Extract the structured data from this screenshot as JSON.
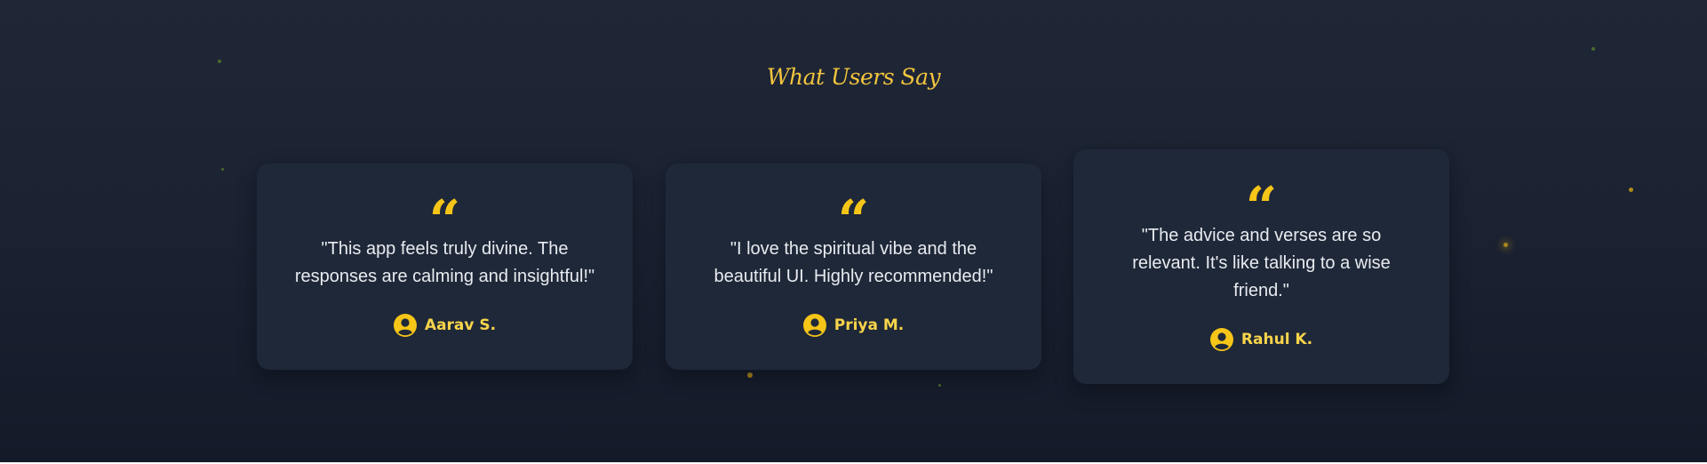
{
  "section": {
    "title": "What Users Say"
  },
  "testimonials": [
    {
      "quote_icon": "quote-left-icon",
      "text": "\"This app feels truly divine. The responses are calming and insightful!\"",
      "author": "Aarav S.",
      "avatar_icon": "user-circle-icon"
    },
    {
      "quote_icon": "quote-left-icon",
      "text": "\"I love the spiritual vibe and the beautiful UI. Highly recommended!\"",
      "author": "Priya M.",
      "avatar_icon": "user-circle-icon"
    },
    {
      "quote_icon": "quote-left-icon",
      "text": "\"The advice and verses are so relevant. It's like talking to a wise friend.\"",
      "author": "Rahul K.",
      "avatar_icon": "user-circle-icon"
    }
  ],
  "colors": {
    "background": "#1b2232",
    "card": "#1f2838",
    "accent": "#f5c518",
    "text": "#e8ebf0"
  }
}
